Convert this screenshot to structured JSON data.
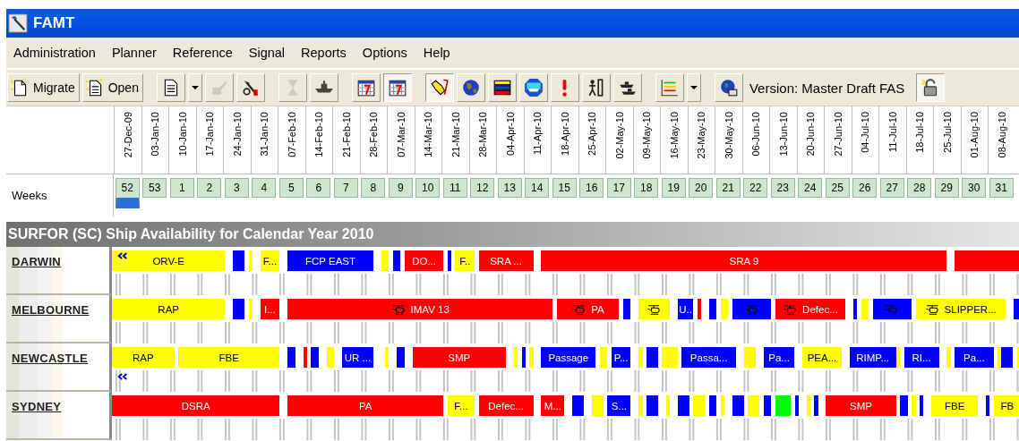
{
  "window": {
    "title": "FAMT"
  },
  "menu": [
    {
      "label": "Administration"
    },
    {
      "label": "Planner"
    },
    {
      "label": "Reference"
    },
    {
      "label": "Signal"
    },
    {
      "label": "Reports"
    },
    {
      "label": "Options"
    },
    {
      "label": "Help"
    }
  ],
  "toolbar": [
    {
      "kind": "text-button",
      "label": "Migrate",
      "pressed": false,
      "disabled": false
    },
    {
      "kind": "text-button",
      "label": "Open",
      "pressed": false,
      "disabled": false
    },
    {
      "kind": "icon-dropdown",
      "pressed": false,
      "disabled": false
    },
    {
      "kind": "icon",
      "pressed": false,
      "disabled": true
    },
    {
      "kind": "icon",
      "pressed": false,
      "disabled": false
    },
    {
      "kind": "icon",
      "pressed": false,
      "disabled": true
    },
    {
      "kind": "icon",
      "pressed": false,
      "disabled": false
    },
    {
      "kind": "icon",
      "pressed": false,
      "disabled": false
    },
    {
      "kind": "icon",
      "pressed": true,
      "disabled": false
    },
    {
      "kind": "icon",
      "pressed": true,
      "disabled": false
    },
    {
      "kind": "icon",
      "pressed": false,
      "disabled": false
    },
    {
      "kind": "icon",
      "pressed": false,
      "disabled": false
    },
    {
      "kind": "icon",
      "pressed": false,
      "disabled": false
    },
    {
      "kind": "icon",
      "pressed": false,
      "disabled": false
    },
    {
      "kind": "icon",
      "pressed": false,
      "disabled": false
    },
    {
      "kind": "icon",
      "pressed": false,
      "disabled": false
    },
    {
      "kind": "icon-dropdown",
      "pressed": false,
      "disabled": false
    },
    {
      "kind": "icon",
      "pressed": false,
      "disabled": false
    },
    {
      "kind": "label",
      "label": "Version: Master Draft FAS"
    },
    {
      "kind": "icon",
      "pressed": true,
      "disabled": false
    }
  ],
  "dates": [
    "27-Dec-09",
    "03-Jan-10",
    "10-Jan-10",
    "17-Jan-10",
    "24-Jan-10",
    "31-Jan-10",
    "07-Feb-10",
    "14-Feb-10",
    "21-Feb-10",
    "28-Feb-10",
    "07-Mar-10",
    "14-Mar-10",
    "21-Mar-10",
    "28-Mar-10",
    "04-Apr-10",
    "11-Apr-10",
    "18-Apr-10",
    "25-Apr-10",
    "02-May-10",
    "09-May-10",
    "16-May-10",
    "23-May-10",
    "30-May-10",
    "06-Jun-10",
    "13-Jun-10",
    "20-Jun-10",
    "27-Jun-10",
    "04-Jul-10",
    "11-Jul-10",
    "18-Jul-10",
    "25-Jul-10",
    "01-Aug-10",
    "08-Aug-10"
  ],
  "weeks_label": "Weeks",
  "weeks": [
    {
      "label": "52",
      "current": true
    },
    {
      "label": "53",
      "current": false
    },
    {
      "label": "1",
      "current": false
    },
    {
      "label": "2",
      "current": false
    },
    {
      "label": "3",
      "current": false
    },
    {
      "label": "4",
      "current": false
    },
    {
      "label": "5",
      "current": false
    },
    {
      "label": "6",
      "current": false
    },
    {
      "label": "7",
      "current": false
    },
    {
      "label": "8",
      "current": false
    },
    {
      "label": "9",
      "current": false
    },
    {
      "label": "10",
      "current": false
    },
    {
      "label": "11",
      "current": false
    },
    {
      "label": "12",
      "current": false
    },
    {
      "label": "13",
      "current": false
    },
    {
      "label": "14",
      "current": false
    },
    {
      "label": "15",
      "current": false
    },
    {
      "label": "16",
      "current": false
    },
    {
      "label": "17",
      "current": false
    },
    {
      "label": "18",
      "current": false
    },
    {
      "label": "19",
      "current": false
    },
    {
      "label": "20",
      "current": false
    },
    {
      "label": "21",
      "current": false
    },
    {
      "label": "22",
      "current": false
    },
    {
      "label": "23",
      "current": false
    },
    {
      "label": "24",
      "current": false
    },
    {
      "label": "25",
      "current": false
    },
    {
      "label": "26",
      "current": false
    },
    {
      "label": "27",
      "current": false
    },
    {
      "label": "28",
      "current": false
    },
    {
      "label": "29",
      "current": false
    },
    {
      "label": "30",
      "current": false
    },
    {
      "label": "31",
      "current": false
    }
  ],
  "plan": {
    "title": "SURFOR (SC) Ship Availability for Calendar Year 2010",
    "ships": [
      {
        "name": "DARWIN",
        "chevron_on_bar": true,
        "chevron_below": false,
        "bars": [
          {
            "color": "#ffff00",
            "text": "ORV-E",
            "heli": false
          },
          {
            "color": "#0000ff",
            "heli": false
          },
          {
            "color": "#ffff00",
            "heli": false
          },
          {
            "color": "#ffff00",
            "text": "F...",
            "heli": false
          },
          {
            "color": "#0000ff",
            "text": "FCP EAST",
            "heli": false
          },
          {
            "color": "#ffff00",
            "heli": false
          },
          {
            "color": "#0000ff",
            "heli": false
          },
          {
            "color": "#ff0000",
            "text": "DO...",
            "heli": false
          },
          {
            "color": "#0000ff",
            "heli": false
          },
          {
            "color": "#ffff00",
            "text": "F..",
            "heli": false
          },
          {
            "color": "#ff0000",
            "text": "SRA ...",
            "heli": false
          },
          {
            "color": "#ff0000",
            "text": "SRA 9",
            "heli": false
          },
          {
            "color": "#ff0000",
            "heli": false
          }
        ]
      },
      {
        "name": "MELBOURNE",
        "chevron_on_bar": false,
        "chevron_below": false,
        "bars": [
          {
            "color": "#ffff00",
            "text": "RAP",
            "heli": false
          },
          {
            "color": "#0000ff",
            "heli": false
          },
          {
            "color": "#ffff00",
            "heli": false
          },
          {
            "color": "#ff0000",
            "text": "I...",
            "heli": false
          },
          {
            "color": "#ff0000",
            "text": "IMAV 13",
            "heli": true
          },
          {
            "color": "#ff0000",
            "text": "PA",
            "heli": true
          },
          {
            "color": "#0000ff",
            "heli": false
          },
          {
            "color": "#ffff00",
            "heli": true
          },
          {
            "color": "#0000ff",
            "text": "U..",
            "heli": false
          },
          {
            "color": "#ff0000",
            "heli": false
          },
          {
            "color": "#0000ff",
            "heli": false
          },
          {
            "color": "#ffff00",
            "heli": false
          },
          {
            "color": "#0000ff",
            "heli": true
          },
          {
            "color": "#ff0000",
            "text": "Defec...",
            "heli": true
          },
          {
            "color": "#0000ff",
            "heli": false
          },
          {
            "color": "#ffff00",
            "heli": false
          },
          {
            "color": "#0000ff",
            "heli": true
          },
          {
            "color": "#ffff00",
            "text": "SLIPPER...",
            "heli": true
          },
          {
            "color": "#0000ff",
            "heli": false
          }
        ]
      },
      {
        "name": "NEWCASTLE",
        "chevron_on_bar": false,
        "chevron_below": true,
        "bars": [
          {
            "color": "#ffff00",
            "text": "RAP",
            "heli": false
          },
          {
            "color": "#ffff00",
            "text": "FBE",
            "heli": false
          },
          {
            "color": "#0000ff",
            "heli": false
          },
          {
            "color": "#ff0000",
            "heli": false
          },
          {
            "color": "#0000ff",
            "heli": false
          },
          {
            "color": "#ffff00",
            "heli": false
          },
          {
            "color": "#0000ff",
            "text": "UR ...",
            "heli": false
          },
          {
            "color": "#ffff00",
            "heli": false
          },
          {
            "color": "#0000ff",
            "heli": false
          },
          {
            "color": "#ff0000",
            "text": "SMP",
            "heli": false
          },
          {
            "color": "#ffff00",
            "heli": false
          },
          {
            "color": "#0000ff",
            "heli": false
          },
          {
            "color": "#ffff00",
            "heli": false
          },
          {
            "color": "#0000ff",
            "text": "Passage",
            "heli": false
          },
          {
            "color": "#ffff00",
            "heli": false
          },
          {
            "color": "#0000ff",
            "text": "P...",
            "heli": false
          },
          {
            "color": "#ffff00",
            "heli": false
          },
          {
            "color": "#0000ff",
            "heli": false
          },
          {
            "color": "#ffff00",
            "heli": false
          },
          {
            "color": "#0000ff",
            "text": "Passa...",
            "heli": false
          },
          {
            "color": "#ffff00",
            "heli": false
          },
          {
            "color": "#0000ff",
            "text": "Pa...",
            "heli": false
          },
          {
            "color": "#ffff00",
            "text": "PEA...",
            "heli": false
          },
          {
            "color": "#0000ff",
            "text": "RIMP...",
            "heli": false
          },
          {
            "color": "#ffff00",
            "heli": false
          },
          {
            "color": "#0000ff",
            "text": "RI...",
            "heli": false
          },
          {
            "color": "#ffff00",
            "heli": false
          },
          {
            "color": "#0000ff",
            "text": "Pa...",
            "heli": false
          },
          {
            "color": "#ffff00",
            "heli": false
          },
          {
            "color": "#0000ff",
            "heli": false
          },
          {
            "color": "#ffff00",
            "heli": false
          }
        ]
      },
      {
        "name": "SYDNEY",
        "chevron_on_bar": false,
        "chevron_below": false,
        "bars": [
          {
            "color": "#ff0000",
            "text": "DSRA",
            "heli": false
          },
          {
            "color": "#ff0000",
            "text": "PA",
            "heli": false
          },
          {
            "color": "#ffff00",
            "text": "F...",
            "heli": false
          },
          {
            "color": "#ff0000",
            "text": "Defec...",
            "heli": false
          },
          {
            "color": "#ff0000",
            "text": "M...",
            "heli": false
          },
          {
            "color": "#0000ff",
            "heli": false
          },
          {
            "color": "#ffff00",
            "heli": false
          },
          {
            "color": "#0000ff",
            "text": "S...",
            "heli": false
          },
          {
            "color": "#ffff00",
            "heli": false
          },
          {
            "color": "#0000ff",
            "heli": false
          },
          {
            "color": "#ffff00",
            "heli": false
          },
          {
            "color": "#0000ff",
            "heli": false
          },
          {
            "color": "#ffff00",
            "heli": false
          },
          {
            "color": "#0000ff",
            "heli": false
          },
          {
            "color": "#ffff00",
            "heli": false
          },
          {
            "color": "#0000ff",
            "heli": false
          },
          {
            "color": "#ffff00",
            "heli": false
          },
          {
            "color": "#0000ff",
            "heli": false
          },
          {
            "color": "#00ff00",
            "heli": false
          },
          {
            "color": "#0000ff",
            "heli": false
          },
          {
            "color": "#ffff00",
            "heli": false
          },
          {
            "color": "#0000ff",
            "heli": false
          },
          {
            "color": "#ff0000",
            "text": "SMP",
            "heli": false
          },
          {
            "color": "#0000ff",
            "heli": false
          },
          {
            "color": "#ffff00",
            "heli": false
          },
          {
            "color": "#0000ff",
            "heli": false
          },
          {
            "color": "#ffff00",
            "text": "FBE",
            "heli": false
          },
          {
            "color": "#0000ff",
            "heli": false
          },
          {
            "color": "#ffff00",
            "text": "FB",
            "heli": false
          }
        ]
      }
    ]
  }
}
